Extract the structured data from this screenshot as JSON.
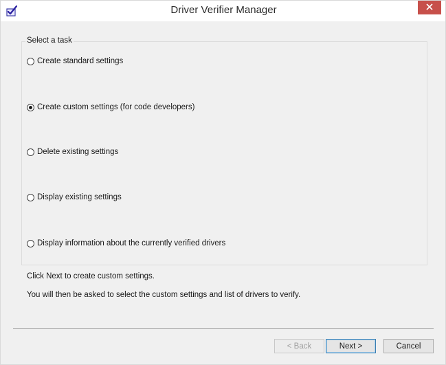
{
  "window": {
    "title": "Driver Verifier Manager"
  },
  "icons": {
    "app_icon": "verifier-checkmark-icon",
    "close": "close-icon"
  },
  "colors": {
    "close_button": "#c7504b",
    "default_button_border": "#3c7fb1"
  },
  "task_group": {
    "label": "Select a task",
    "options": [
      {
        "label": "Create standard settings",
        "selected": false
      },
      {
        "label": "Create custom settings (for code developers)",
        "selected": true
      },
      {
        "label": "Delete existing settings",
        "selected": false
      },
      {
        "label": "Display existing settings",
        "selected": false
      },
      {
        "label": "Display information about the currently verified drivers",
        "selected": false
      }
    ]
  },
  "info": {
    "line1": "Click Next to create custom settings.",
    "line2": "You will then be asked to select the custom settings and list of drivers to verify."
  },
  "buttons": {
    "back": "< Back",
    "next": "Next >",
    "cancel": "Cancel"
  }
}
